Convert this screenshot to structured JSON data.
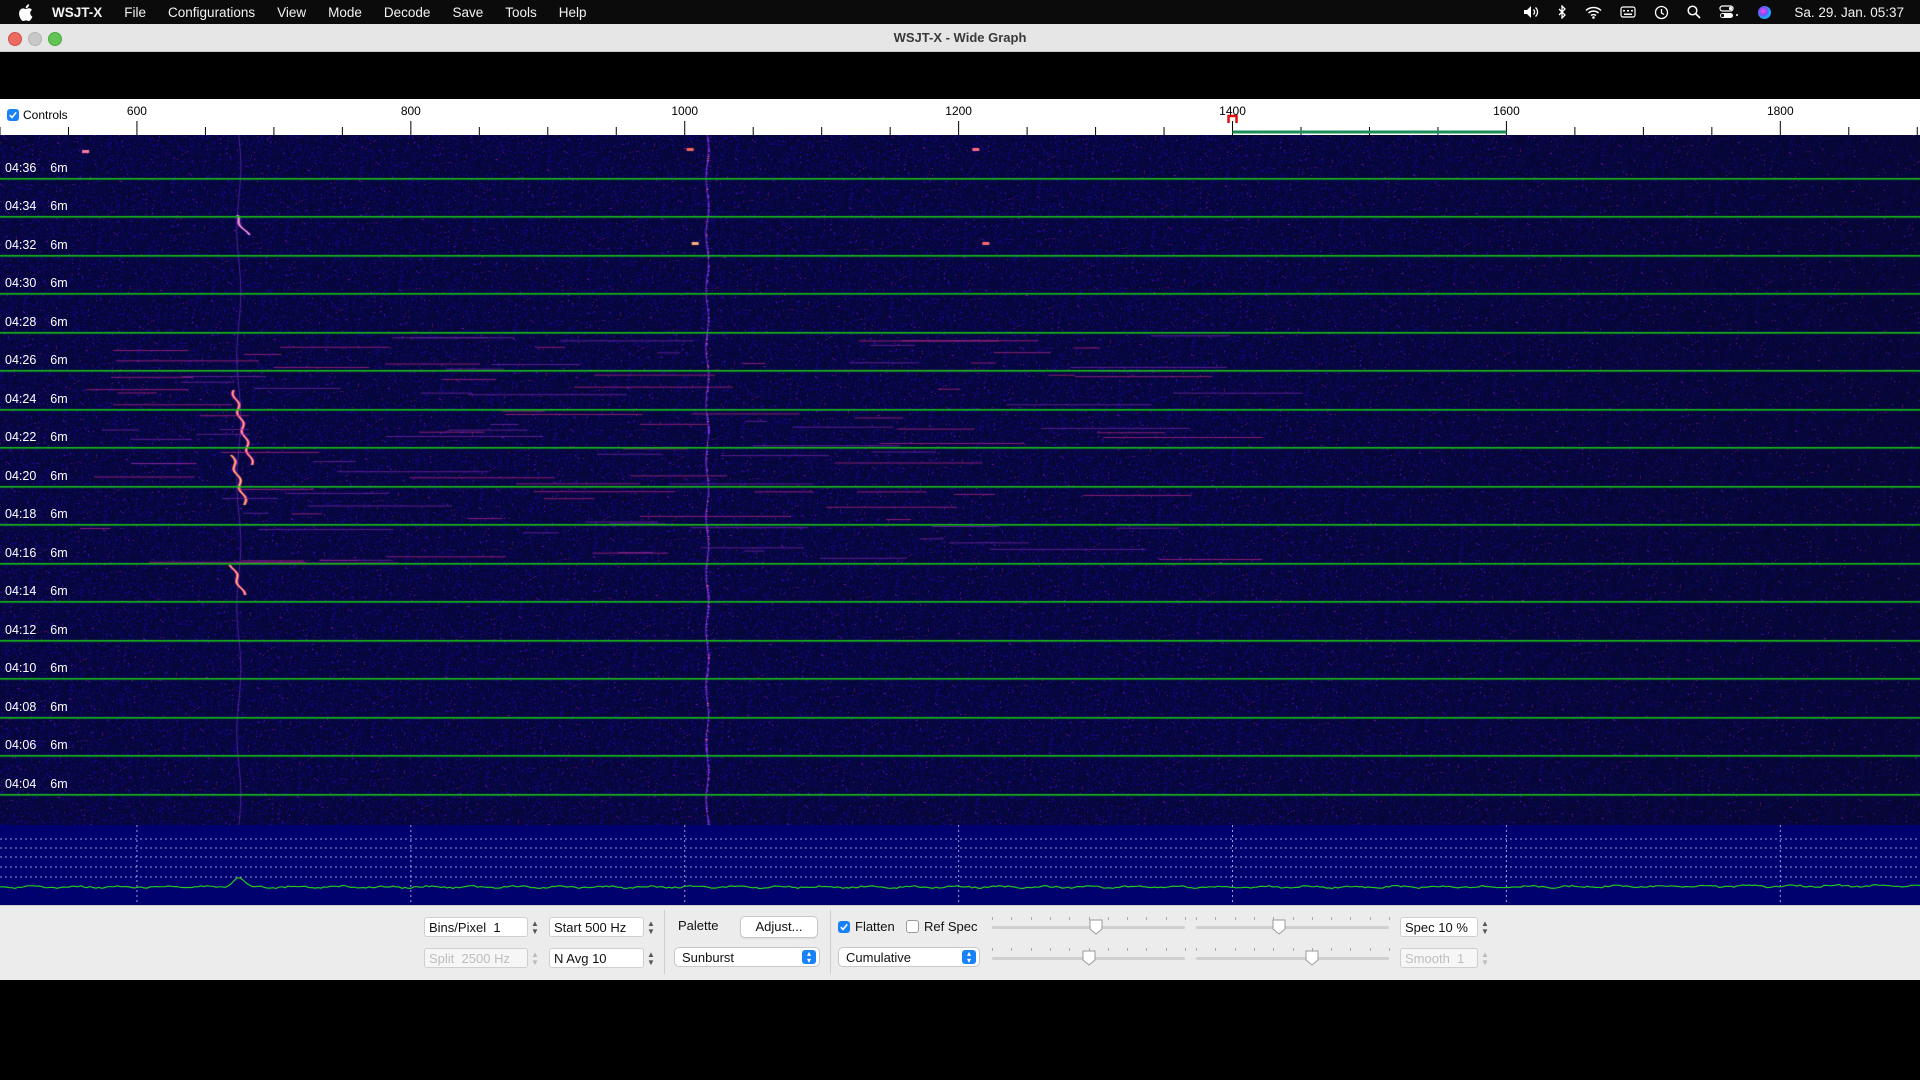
{
  "menubar": {
    "app_name": "WSJT-X",
    "items": [
      "File",
      "Configurations",
      "View",
      "Mode",
      "Decode",
      "Save",
      "Tools",
      "Help"
    ],
    "clock": "Sa. 29. Jan.  05:37"
  },
  "window": {
    "title": "WSJT-X - Wide Graph"
  },
  "scale": {
    "controls_label": "Controls",
    "controls_checked": true,
    "freq_min_hz": 500,
    "freq_max_hz": 1902,
    "tick_labels": [
      "600",
      "800",
      "1000",
      "1200",
      "1400",
      "1600",
      "1800"
    ],
    "tx_marker_hz": 1400,
    "rx_band_hz": [
      1400,
      1600
    ],
    "marker_color": "#e01010",
    "band_color": "#1a8f5a"
  },
  "waterfall": {
    "rows": [
      {
        "time": "04:36",
        "band": "6m"
      },
      {
        "time": "04:34",
        "band": "6m"
      },
      {
        "time": "04:32",
        "band": "6m"
      },
      {
        "time": "04:30",
        "band": "6m"
      },
      {
        "time": "04:28",
        "band": "6m"
      },
      {
        "time": "04:26",
        "band": "6m"
      },
      {
        "time": "04:24",
        "band": "6m"
      },
      {
        "time": "04:22",
        "band": "6m"
      },
      {
        "time": "04:20",
        "band": "6m"
      },
      {
        "time": "04:18",
        "band": "6m"
      },
      {
        "time": "04:16",
        "band": "6m"
      },
      {
        "time": "04:14",
        "band": "6m"
      },
      {
        "time": "04:12",
        "band": "6m"
      },
      {
        "time": "04:10",
        "band": "6m"
      },
      {
        "time": "04:08",
        "band": "6m"
      },
      {
        "time": "04:06",
        "band": "6m"
      },
      {
        "time": "04:04",
        "band": "6m"
      }
    ],
    "separator_color": "#18c018",
    "background_color": "#0a0a3a",
    "signal_traces_hz": [
      {
        "freq_hz": 1016,
        "note": "vertical carrier trace"
      },
      {
        "freq_hz": 674,
        "note": "bright drifting trace"
      }
    ]
  },
  "spectrum": {
    "background_color": "#00006e",
    "trace_color": "#22c822",
    "peak_freq_hz": 674
  },
  "controls": {
    "bins_per_pixel": {
      "label": "Bins/Pixel",
      "value": "1"
    },
    "start": {
      "label": "Start",
      "value": "500 Hz"
    },
    "split": {
      "label": "Split",
      "value": "2500 Hz",
      "disabled": true
    },
    "n_avg": {
      "label": "N Avg",
      "value": "10"
    },
    "palette_label": "Palette",
    "adjust_label": "Adjust...",
    "palette_value": "Sunburst",
    "flatten": {
      "label": "Flatten",
      "checked": true
    },
    "ref_spec": {
      "label": "Ref Spec",
      "checked": false
    },
    "spectrum_mode": "Cumulative",
    "spec": {
      "label": "Spec",
      "value": "10 %"
    },
    "smooth": {
      "label": "Smooth",
      "value": "1",
      "disabled": true
    },
    "slider_levels_pct": [
      54,
      43,
      50,
      60
    ]
  }
}
